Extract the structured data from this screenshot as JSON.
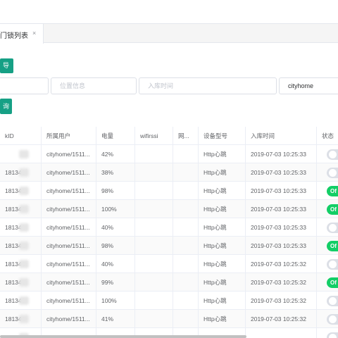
{
  "tab": {
    "label": "门锁列表",
    "close": "×"
  },
  "toolbar": {
    "import_label": "导入",
    "query_label": "询"
  },
  "filters": {
    "f1": {
      "value": ""
    },
    "location": {
      "placeholder": "位置信息"
    },
    "entry_time": {
      "placeholder": "入库时间"
    },
    "account": {
      "value": "cityhome"
    }
  },
  "table": {
    "headers": [
      "kID",
      "所属用户",
      "电量",
      "wifirssi",
      "网...",
      "设备型号",
      "入库时间",
      "状态"
    ],
    "rows": [
      {
        "id": "",
        "user": "cityhome/1511...",
        "battery": "42%",
        "wifirssi": "",
        "net": "",
        "model": "Http心跳",
        "time": "2019-07-03 10:25:33",
        "status": "off",
        "status_label": ""
      },
      {
        "id": "181341",
        "user": "cityhome/1511...",
        "battery": "38%",
        "wifirssi": "",
        "net": "",
        "model": "Http心跳",
        "time": "2019-07-03 10:25:33",
        "status": "off",
        "status_label": ""
      },
      {
        "id": "181341",
        "user": "cityhome/1511...",
        "battery": "98%",
        "wifirssi": "",
        "net": "",
        "model": "Http心跳",
        "time": "2019-07-03 10:25:33",
        "status": "on",
        "status_label": "Of"
      },
      {
        "id": "181341",
        "user": "cityhome/1511...",
        "battery": "100%",
        "wifirssi": "",
        "net": "",
        "model": "Http心跳",
        "time": "2019-07-03 10:25:33",
        "status": "on",
        "status_label": "Of"
      },
      {
        "id": "181341",
        "user": "cityhome/1511...",
        "battery": "40%",
        "wifirssi": "",
        "net": "",
        "model": "Http心跳",
        "time": "2019-07-03 10:25:33",
        "status": "off",
        "status_label": ""
      },
      {
        "id": "181341",
        "user": "cityhome/1511...",
        "battery": "98%",
        "wifirssi": "",
        "net": "",
        "model": "Http心跳",
        "time": "2019-07-03 10:25:33",
        "status": "on",
        "status_label": "Of"
      },
      {
        "id": "181341",
        "user": "cityhome/1511...",
        "battery": "40%",
        "wifirssi": "",
        "net": "",
        "model": "Http心跳",
        "time": "2019-07-03 10:25:32",
        "status": "off",
        "status_label": ""
      },
      {
        "id": "181341",
        "user": "cityhome/1511...",
        "battery": "99%",
        "wifirssi": "",
        "net": "",
        "model": "Http心跳",
        "time": "2019-07-03 10:25:32",
        "status": "on",
        "status_label": "Of"
      },
      {
        "id": "181341",
        "user": "cityhome/1511...",
        "battery": "100%",
        "wifirssi": "",
        "net": "",
        "model": "Http心跳",
        "time": "2019-07-03 10:25:32",
        "status": "off",
        "status_label": ""
      },
      {
        "id": "181341",
        "user": "cityhome/1511...",
        "battery": "41%",
        "wifirssi": "",
        "net": "",
        "model": "Http心跳",
        "time": "2019-07-03 10:25:32",
        "status": "off",
        "status_label": ""
      },
      {
        "id": "",
        "user": "",
        "battery": "",
        "wifirssi": "",
        "net": "",
        "model": "",
        "time": "",
        "status": "off",
        "status_label": ""
      }
    ]
  },
  "colors": {
    "accent": "#16a085",
    "switch_on": "#13ce66",
    "switch_off": "#dcdfe6"
  }
}
